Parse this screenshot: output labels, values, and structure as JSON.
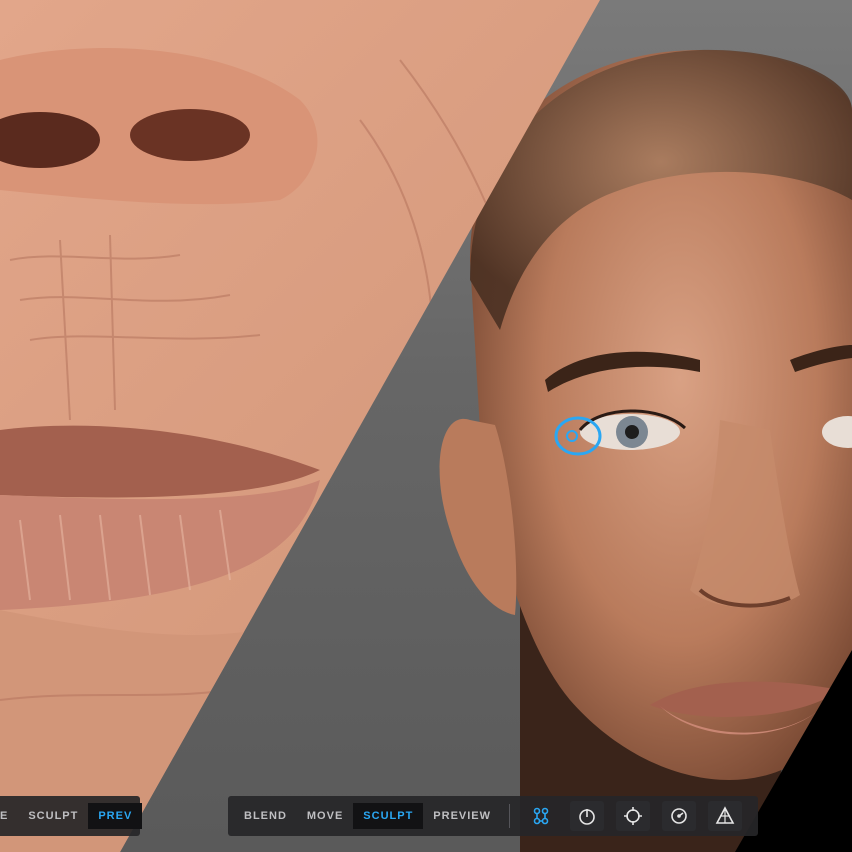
{
  "toolbar": {
    "modes": [
      {
        "label": "BLEND"
      },
      {
        "label": "MOVE"
      },
      {
        "label": "SCULPT",
        "active": true
      },
      {
        "label": "PREVIEW"
      }
    ],
    "ghost_modes": [
      {
        "label": "E"
      },
      {
        "label": "SCULPT"
      },
      {
        "label": "PREV",
        "active": true
      }
    ],
    "tools": [
      {
        "icon": "symmetry-links-icon",
        "active": true
      },
      {
        "icon": "power-circle-icon"
      },
      {
        "icon": "head-target-icon"
      },
      {
        "icon": "clock-dial-icon"
      },
      {
        "icon": "pyramid-mesh-icon"
      }
    ]
  },
  "colors": {
    "accent": "#2aa7f3",
    "toolbar_bg": "#262628",
    "backdrop": "#6b6b6b"
  }
}
